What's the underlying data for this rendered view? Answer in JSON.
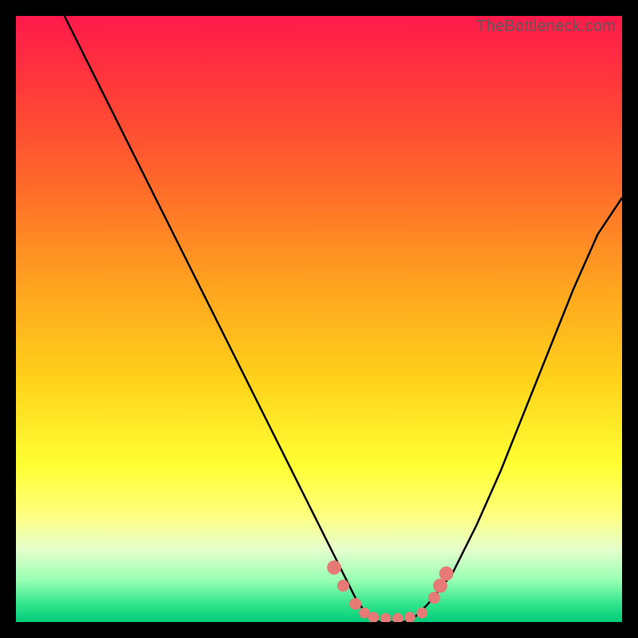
{
  "watermark": "TheBottleneck.com",
  "colors": {
    "background": "#000000",
    "dot": "#e77a75",
    "curve": "#000000"
  },
  "chart_data": {
    "type": "line",
    "title": "",
    "xlabel": "",
    "ylabel": "",
    "xlim": [
      0,
      100
    ],
    "ylim": [
      0,
      100
    ],
    "grid": false,
    "series": [
      {
        "name": "bottleneck-curve",
        "x": [
          8,
          12,
          16,
          20,
          24,
          28,
          32,
          36,
          40,
          44,
          48,
          52,
          54,
          56,
          58,
          60,
          62,
          64,
          66,
          68,
          72,
          76,
          80,
          84,
          88,
          92,
          96,
          100
        ],
        "y": [
          100,
          92,
          84,
          76,
          68,
          60,
          52,
          44,
          36,
          28,
          20,
          12,
          8,
          4,
          1,
          0,
          0,
          0,
          1,
          3,
          8,
          16,
          25,
          35,
          45,
          55,
          64,
          70
        ]
      }
    ],
    "markers": [
      {
        "x": 52.5,
        "y": 9.0,
        "r": 1.2
      },
      {
        "x": 54.0,
        "y": 6.0,
        "r": 1.0
      },
      {
        "x": 56.0,
        "y": 3.0,
        "r": 1.0
      },
      {
        "x": 57.5,
        "y": 1.5,
        "r": 0.9
      },
      {
        "x": 59.0,
        "y": 0.8,
        "r": 0.9
      },
      {
        "x": 61.0,
        "y": 0.6,
        "r": 0.9
      },
      {
        "x": 63.0,
        "y": 0.6,
        "r": 0.9
      },
      {
        "x": 65.0,
        "y": 0.8,
        "r": 0.9
      },
      {
        "x": 67.0,
        "y": 1.5,
        "r": 0.9
      },
      {
        "x": 69.0,
        "y": 4.0,
        "r": 1.0
      },
      {
        "x": 70.0,
        "y": 6.0,
        "r": 1.2
      },
      {
        "x": 71.0,
        "y": 8.0,
        "r": 1.2
      }
    ]
  }
}
